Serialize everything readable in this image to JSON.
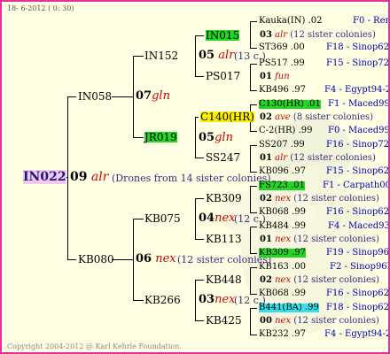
{
  "header": {
    "date": "18-  6-2012 (  0: 30)"
  },
  "footer": {
    "copyright": "Copyright 2004-2012 @ Karl Kehrle Foundation."
  },
  "root": {
    "name": "IN022",
    "num": "09",
    "race": "alr",
    "note": "(Drones from 14 sister colonies)"
  },
  "g1": [
    {
      "name": "IN058",
      "num": "07",
      "race": "gln"
    },
    {
      "name": "KB080",
      "num": "06",
      "race": "nex",
      "note": "(12 sister colonies)"
    }
  ],
  "g2": [
    {
      "name": "IN152",
      "num": "05",
      "race": "alr",
      "note": "(13 c.)"
    },
    {
      "name": "JR019",
      "num": "05",
      "race": "gln"
    },
    {
      "name": "KB075",
      "num": "04",
      "race": "nex",
      "note": "(12 c.)"
    },
    {
      "name": "KB266",
      "num": "03",
      "race": "nex",
      "note": "(12 c.)"
    }
  ],
  "g3": [
    "IN015",
    "PS017",
    "C140(HR)",
    "SS247",
    "KB309",
    "KB113",
    "KB448",
    "KB425"
  ],
  "g4": [
    {
      "name": "Kauka(IN) .02",
      "right": "F0 - Ren"
    },
    {
      "num": "03",
      "race": "alr",
      "note": "(12 sister colonies)"
    },
    {
      "name": "ST369 .00",
      "right": "F18 - Sinop62R"
    },
    {
      "name": "PS517 .99",
      "right": "F15 - Sinop72R"
    },
    {
      "num": "01",
      "race": "fun"
    },
    {
      "name": "KB496 .97",
      "right": "F4 - Egypt94-2R"
    },
    {
      "name": "C130(HR) .01",
      "right": "F1 - Maced99Q"
    },
    {
      "num": "02",
      "race": "ave",
      "note": "(8 sister colonies)"
    },
    {
      "name": "C-2(HR) .99",
      "right": "F0 - Maced99Q"
    },
    {
      "name": "SS207 .99",
      "right": "F16 - Sinop72R"
    },
    {
      "num": "01",
      "race": "alr",
      "note": "(12 sister colonies)"
    },
    {
      "name": "KB096 .97",
      "right": "F15 - Sinop62R"
    },
    {
      "name": "FS723 .01",
      "right": "F1 - Carpath00R"
    },
    {
      "num": "02",
      "race": "nex",
      "note": "(12 sister colonies)"
    },
    {
      "name": "KB068 .99",
      "right": "F16 - Sinop62R"
    },
    {
      "name": "KB484 .99",
      "right": "F4 - Maced93R"
    },
    {
      "num": "01",
      "race": "nex",
      "note": "(12 sister colonies)"
    },
    {
      "name": "KB309 .97",
      "right": "F19 - Sinop96R"
    },
    {
      "name": "KB163 .00",
      "right": "F2 - Sinop96R"
    },
    {
      "num": "02",
      "race": "nex",
      "note": "(12 sister colonies)"
    },
    {
      "name": "KB068 .99",
      "right": "F16 - Sinop62R"
    },
    {
      "name": "B441(BA) .99",
      "right": "F18 - Sinop62R"
    },
    {
      "num": "00",
      "race": "nex",
      "note": "(12 sister colonies)"
    },
    {
      "name": "KB232 .97",
      "right": "F4 - Egypt94-2R"
    }
  ]
}
